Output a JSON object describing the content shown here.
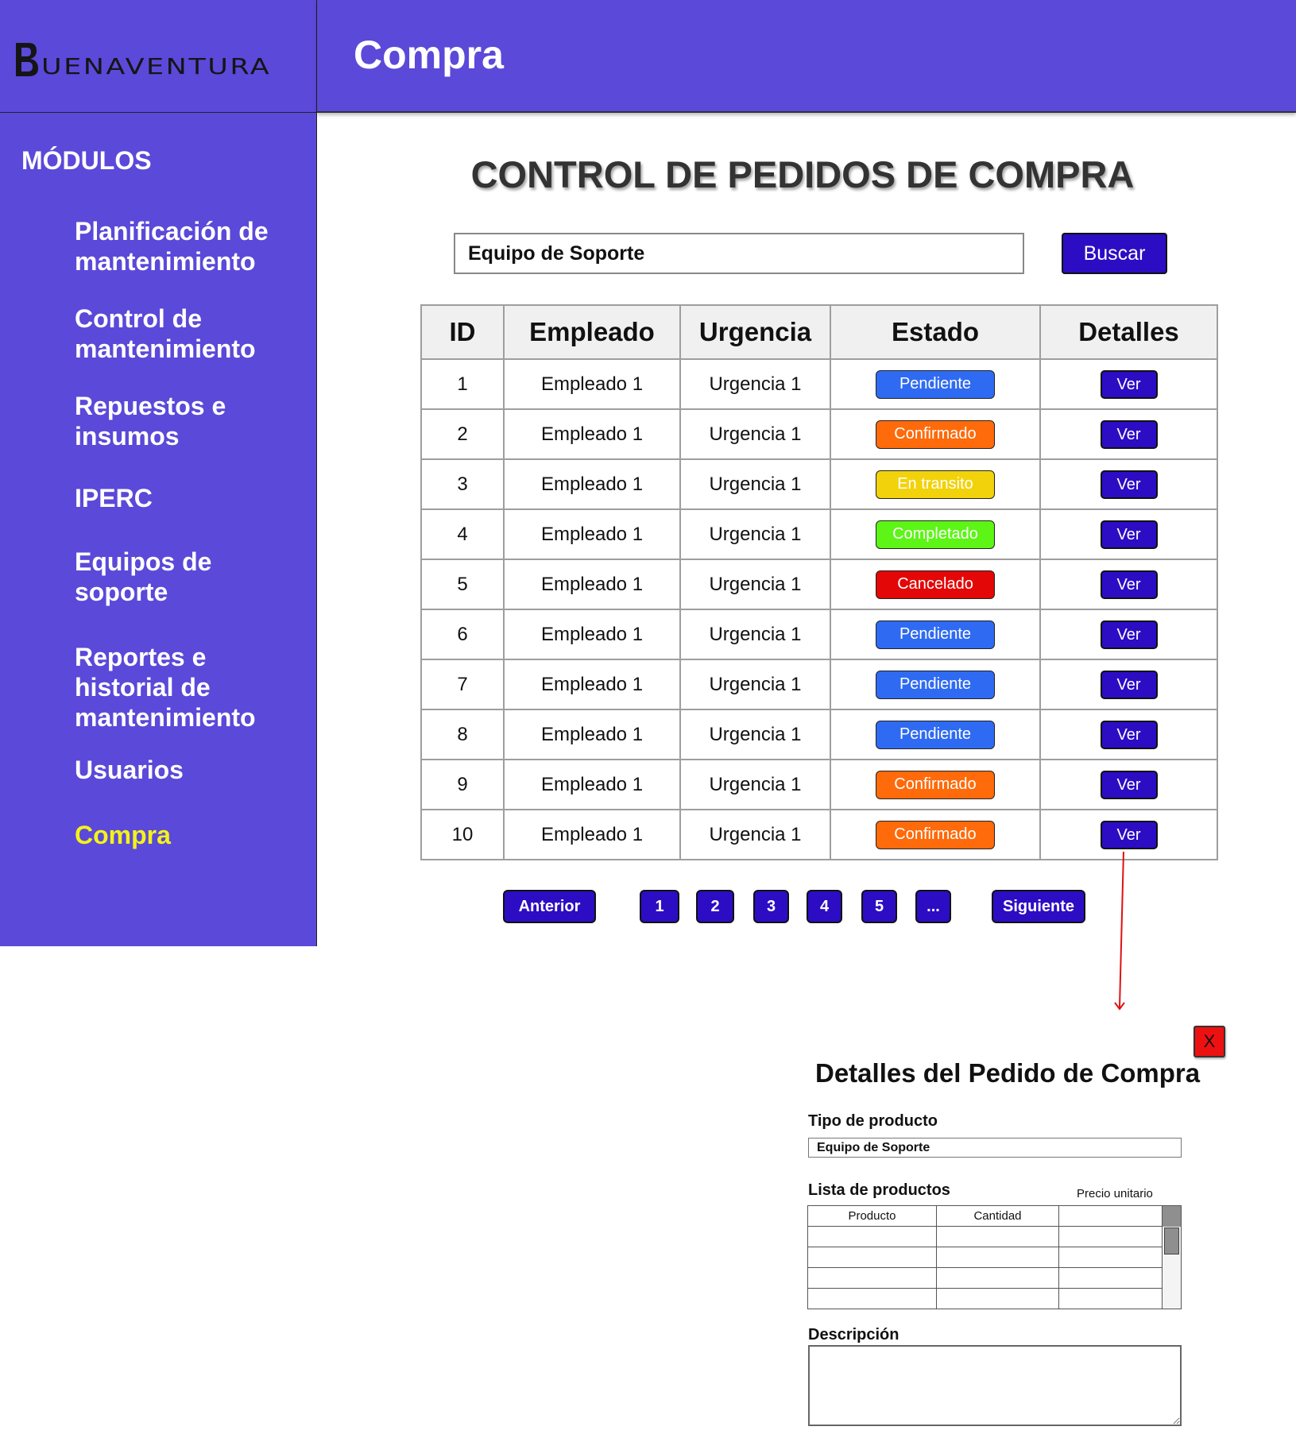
{
  "brand": {
    "logo_text": "UENAVENTURA",
    "logo_letter": "B"
  },
  "header": {
    "title": "Compra"
  },
  "sidebar": {
    "heading": "MÓDULOS",
    "items": [
      {
        "label": "Planificación de mantenimiento"
      },
      {
        "label": "Control de mantenimiento"
      },
      {
        "label": "Repuestos e insumos"
      },
      {
        "label": "IPERC"
      },
      {
        "label": "Equipos de soporte"
      },
      {
        "label": "Reportes e historial de mantenimiento"
      },
      {
        "label": "Usuarios"
      },
      {
        "label": "Compra"
      }
    ],
    "active_item": "Compra"
  },
  "main": {
    "title": "CONTROL DE PEDIDOS DE COMPRA",
    "search": {
      "value": "Equipo de Soporte",
      "button_label": "Buscar"
    },
    "table": {
      "headers": {
        "id": "ID",
        "employee": "Empleado",
        "urgency": "Urgencia",
        "status": "Estado",
        "details": "Detalles"
      },
      "rows": [
        {
          "id": "1",
          "employee": "Empleado 1",
          "urgency": "Urgencia 1",
          "status": "Pendiente",
          "action": "Ver"
        },
        {
          "id": "2",
          "employee": "Empleado 1",
          "urgency": "Urgencia 1",
          "status": "Confirmado",
          "action": "Ver"
        },
        {
          "id": "3",
          "employee": "Empleado 1",
          "urgency": "Urgencia 1",
          "status": "En transito",
          "action": "Ver"
        },
        {
          "id": "4",
          "employee": "Empleado 1",
          "urgency": "Urgencia 1",
          "status": "Completado",
          "action": "Ver"
        },
        {
          "id": "5",
          "employee": "Empleado 1",
          "urgency": "Urgencia 1",
          "status": "Cancelado",
          "action": "Ver"
        },
        {
          "id": "6",
          "employee": "Empleado 1",
          "urgency": "Urgencia 1",
          "status": "Pendiente",
          "action": "Ver"
        },
        {
          "id": "7",
          "employee": "Empleado 1",
          "urgency": "Urgencia 1",
          "status": "Pendiente",
          "action": "Ver"
        },
        {
          "id": "8",
          "employee": "Empleado 1",
          "urgency": "Urgencia 1",
          "status": "Pendiente",
          "action": "Ver"
        },
        {
          "id": "9",
          "employee": "Empleado 1",
          "urgency": "Urgencia 1",
          "status": "Confirmado",
          "action": "Ver"
        },
        {
          "id": "10",
          "employee": "Empleado 1",
          "urgency": "Urgencia 1",
          "status": "Confirmado",
          "action": "Ver"
        }
      ]
    },
    "status_colors": {
      "Pendiente": "#2f6bf2",
      "Confirmado": "#ff6a0a",
      "En transito": "#f2d20a",
      "Completado": "#5cf516",
      "Cancelado": "#e30707"
    },
    "pagination": {
      "prev": "Anterior",
      "pages": [
        "1",
        "2",
        "3",
        "4",
        "5",
        "..."
      ],
      "next": "Siguiente"
    }
  },
  "details_panel": {
    "close_label": "X",
    "title": "Detalles del Pedido de Compra",
    "product_type_label": "Tipo de producto",
    "product_type_value": "Equipo de Soporte",
    "products_list_label": "Lista de productos",
    "unit_price_label": "Precio unitario",
    "products_headers": {
      "product": "Producto",
      "quantity": "Cantidad"
    },
    "description_label": "Descripción"
  },
  "colors": {
    "brand_purple": "#5b49d9",
    "button_blue": "#2c0dc4",
    "active_nav": "#f3f318",
    "close_red": "#ee1111",
    "arrow_red": "#e01010"
  }
}
